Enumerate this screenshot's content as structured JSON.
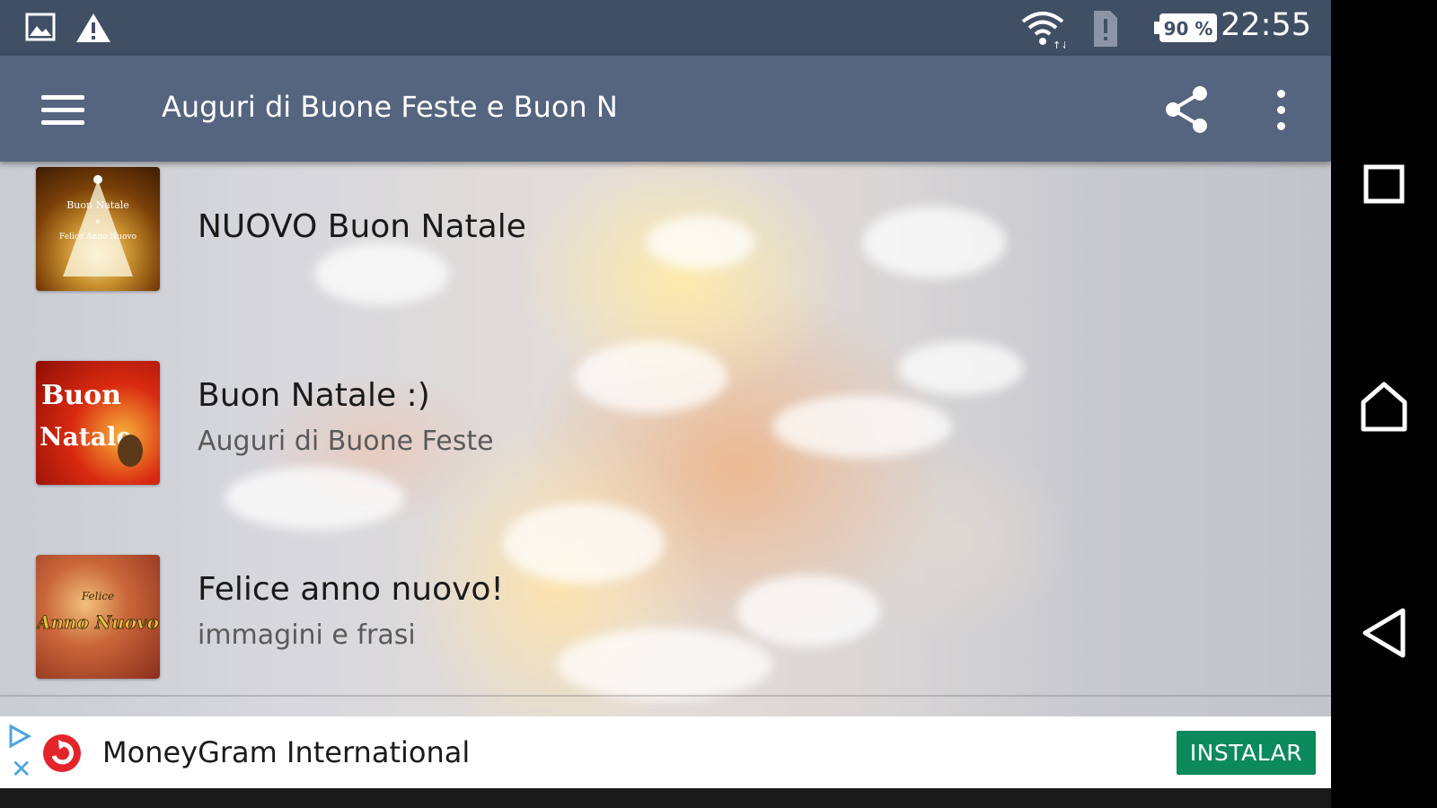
{
  "status_bar": {
    "time": "22:55",
    "battery": "90 %",
    "icons": [
      "gallery-icon",
      "warning-icon",
      "wifi-icon",
      "sim-alert-icon",
      "battery-icon"
    ]
  },
  "app_bar": {
    "title": "Auguri di Buone Feste e Buon N",
    "icons": [
      "menu-icon",
      "share-icon",
      "overflow-menu-icon"
    ]
  },
  "list": {
    "items": [
      {
        "title": "NUOVO Buon Natale",
        "subtitle": "",
        "thumb_text": [
          "Buon Natale",
          "e",
          "Felice Anno Nuovo"
        ]
      },
      {
        "title": "Buon Natale :)",
        "subtitle": "Auguri di Buone Feste",
        "thumb_text": [
          "Buon",
          "Natale"
        ]
      },
      {
        "title": "Felice anno nuovo!",
        "subtitle": "immagini e frasi",
        "thumb_text": [
          "Felice",
          "Anno Nuovo"
        ]
      }
    ]
  },
  "ad": {
    "title": "MoneyGram International",
    "button": "INSTALAR",
    "colors": {
      "button": "#0d8a5b",
      "logo": "#e3242b",
      "adchoices": "#4fa3e0"
    }
  },
  "nav_bar": {
    "buttons": [
      "recents-icon",
      "home-icon",
      "back-icon"
    ]
  },
  "colors": {
    "status_bar": "#414f65",
    "app_bar": "#55657f"
  }
}
